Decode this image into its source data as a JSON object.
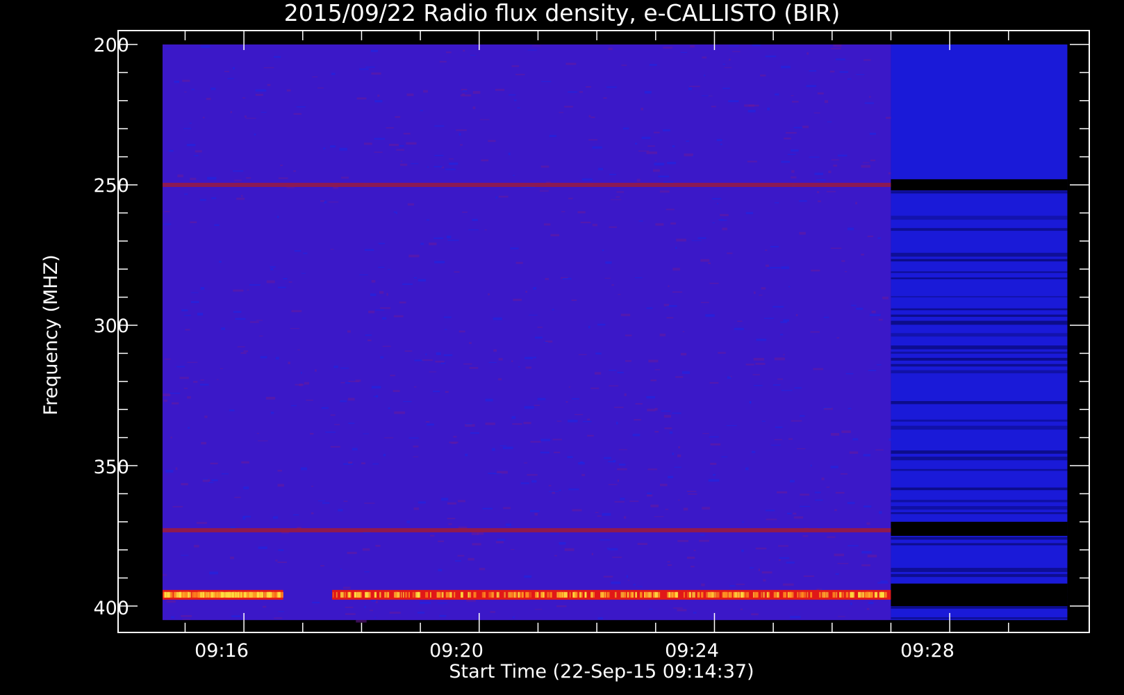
{
  "chart_data": {
    "type": "heatmap",
    "title": "2015/09/22  Radio flux density, e-CALLISTO (BIR)",
    "xlabel": "Start Time (22-Sep-15 09:14:37)",
    "ylabel": "Frequency (MHZ)",
    "x_ticks": [
      "09:16",
      "09:20",
      "09:24",
      "09:28"
    ],
    "y_ticks": [
      "200",
      "250",
      "300",
      "350",
      "400"
    ],
    "xlim": [
      "09:14:37",
      "09:30:00"
    ],
    "ylim": [
      200,
      405
    ],
    "y_inverted": true,
    "data_start": "09:14:37",
    "data_end": "09:30:00",
    "segment_change": "09:27:00",
    "colors": {
      "background": "#000000",
      "noise_a": "#3b18c8",
      "noise_b": "#6a1a9a",
      "segment2_base": "#1a1ad8",
      "hot_low": "#e01818",
      "hot_high": "#ffe040"
    },
    "emission_bands_mhz": [
      {
        "freq": 250,
        "segment": 1,
        "intensity": 0.35
      },
      {
        "freq": 373,
        "segment": 1,
        "intensity": 0.4
      },
      {
        "freq": 396,
        "segment": 1,
        "intensity": 1.0,
        "from": "09:17:30",
        "to": "09:27:00"
      },
      {
        "freq": 396,
        "segment": 1,
        "intensity": 0.8,
        "from": "09:14:37",
        "to": "09:16:40"
      }
    ],
    "gap_bands_mhz_segment2": [
      [
        248,
        252
      ],
      [
        370,
        375
      ],
      [
        392,
        400
      ]
    ]
  }
}
